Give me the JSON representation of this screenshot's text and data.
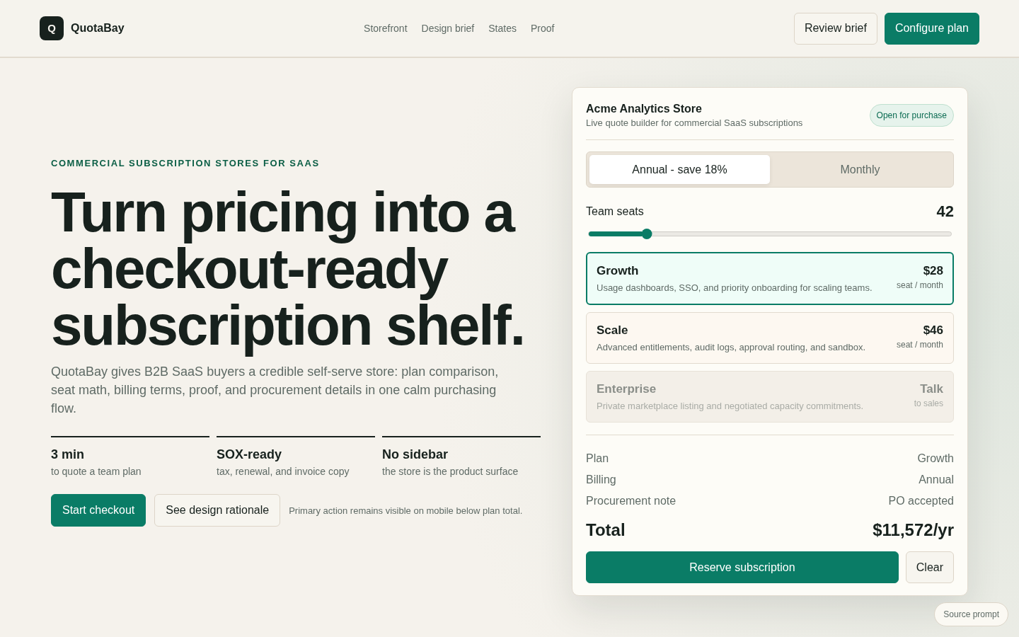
{
  "header": {
    "logo_mark": "Q",
    "brand": "QuotaBay",
    "nav": [
      "Storefront",
      "Design brief",
      "States",
      "Proof"
    ],
    "actions": [
      {
        "label": "Review brief",
        "kind": "secondary"
      },
      {
        "label": "Configure plan",
        "kind": "primary"
      }
    ]
  },
  "hero": {
    "eyebrow": "COMMERCIAL SUBSCRIPTION STORES FOR SAAS",
    "headline": "Turn pricing into a checkout-ready subscription shelf.",
    "description": "QuotaBay gives B2B SaaS buyers a credible self-serve store: plan comparison, seat math, billing terms, proof, and procurement details in one calm purchasing flow.",
    "stats": [
      {
        "value": "3 min",
        "caption": "to quote a team plan"
      },
      {
        "value": "SOX-ready",
        "caption": "tax, renewal, and invoice copy"
      },
      {
        "value": "No sidebar",
        "caption": "the store is the product surface"
      }
    ],
    "actions": [
      {
        "label": "Start checkout",
        "kind": "primary"
      },
      {
        "label": "See design rationale",
        "kind": "secondary"
      }
    ],
    "note": "Primary action remains visible on mobile below plan total."
  },
  "store": {
    "title": "Acme Analytics Store",
    "subtitle": "Live quote builder for commercial SaaS subscriptions",
    "status_badge": "Open for purchase",
    "billing_tabs": [
      {
        "label": "Annual - save 18%",
        "selected": true
      },
      {
        "label": "Monthly",
        "selected": false
      }
    ],
    "seats": {
      "label": "Team seats",
      "value": "42",
      "level": 0.16
    },
    "plans": [
      {
        "name": "Growth",
        "description": "Usage dashboards, SSO, and priority onboarding for scaling teams.",
        "price": "$28",
        "unit": "seat / month",
        "selected": true,
        "disabled": false
      },
      {
        "name": "Scale",
        "description": "Advanced entitlements, audit logs, approval routing, and sandbox.",
        "price": "$46",
        "unit": "seat / month",
        "selected": false,
        "disabled": false
      },
      {
        "name": "Enterprise",
        "description": "Private marketplace listing and negotiated capacity commitments.",
        "price": "Talk",
        "unit": "to sales",
        "selected": false,
        "disabled": true
      }
    ],
    "summary": [
      {
        "label": "Plan",
        "value": "Growth"
      },
      {
        "label": "Billing",
        "value": "Annual"
      },
      {
        "label": "Procurement note",
        "value": "PO accepted"
      }
    ],
    "total": {
      "label": "Total",
      "value": "$11,572/yr"
    },
    "actions": [
      {
        "label": "Reserve subscription",
        "kind": "primary"
      },
      {
        "label": "Clear",
        "kind": "secondary"
      }
    ]
  },
  "source_prompt_button": "Source prompt"
}
